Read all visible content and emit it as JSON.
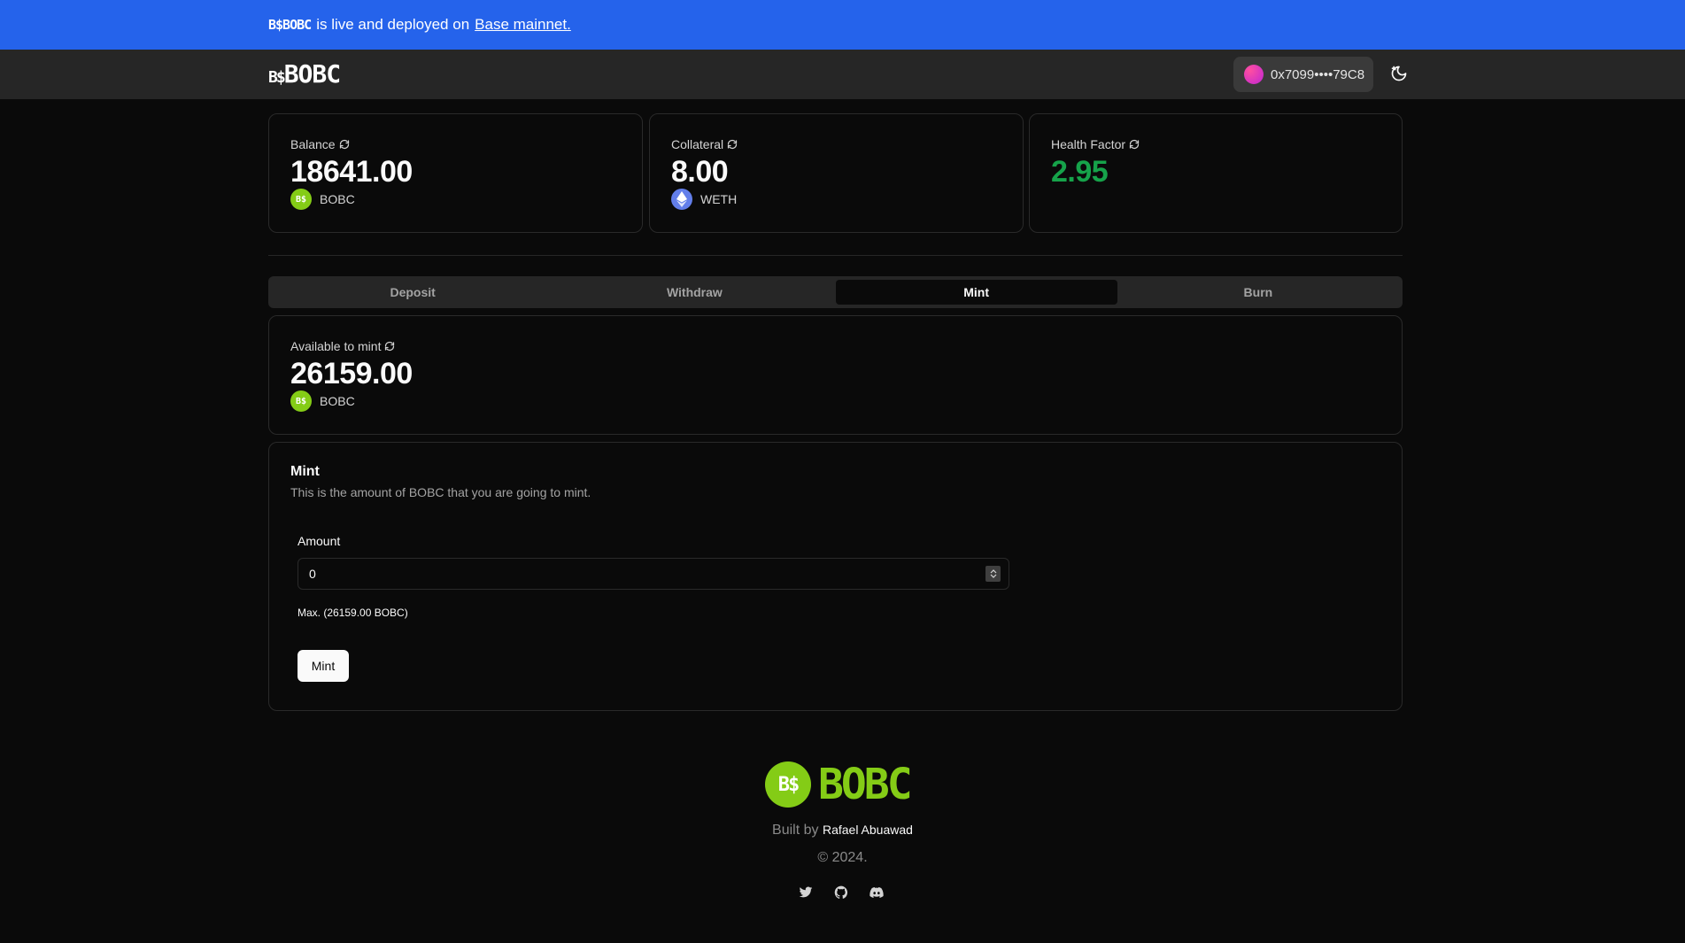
{
  "banner": {
    "logo_text": "B$BOBC",
    "text": "is live and deployed on",
    "link_label": "Base mainnet."
  },
  "nav": {
    "logo_prefix": "B$",
    "logo_word": "BOBC",
    "wallet_address": "0x7099••••79C8",
    "theme_icon": "moon-sun-icon"
  },
  "stats": [
    {
      "label": "Balance",
      "value": "18641.00",
      "token": "BOBC",
      "token_icon": "bobc-token-icon"
    },
    {
      "label": "Collateral",
      "value": "8.00",
      "token": "WETH",
      "token_icon": "eth-token-icon"
    },
    {
      "label": "Health Factor",
      "value": "2.95",
      "value_color": "#16a34a"
    }
  ],
  "tabs": [
    {
      "label": "Deposit",
      "active": false
    },
    {
      "label": "Withdraw",
      "active": false
    },
    {
      "label": "Mint",
      "active": true
    },
    {
      "label": "Burn",
      "active": false
    }
  ],
  "available": {
    "label": "Available to mint",
    "value": "26159.00",
    "token": "BOBC"
  },
  "mint_form": {
    "title": "Mint",
    "description": "This is the amount of BOBC that you are going to mint.",
    "amount_label": "Amount",
    "amount_value": "0",
    "max_text": "Max. (26159.00 BOBC)",
    "submit_label": "Mint"
  },
  "footer": {
    "token_text": "B$",
    "logo_word": "BOBC",
    "built_by": "Built by",
    "author": "Rafael Abuawad",
    "copyright": "© 2024.",
    "socials": [
      "twitter-icon",
      "github-icon",
      "discord-icon"
    ]
  },
  "colors": {
    "banner": "#2563eb",
    "accent_green": "#84cc16",
    "health_green": "#16a34a",
    "background": "#0a0a0a"
  }
}
